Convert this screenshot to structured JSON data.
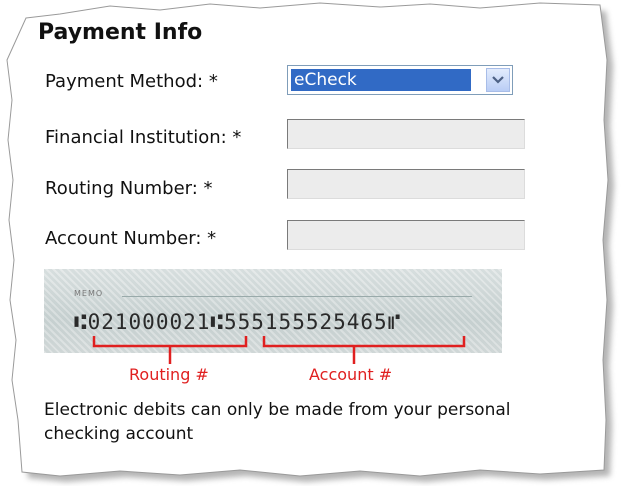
{
  "section_title": "Payment Info",
  "fields": {
    "payment_method": {
      "label": "Payment Method: *",
      "value": "eCheck"
    },
    "financial_institution": {
      "label": "Financial Institution: *",
      "value": ""
    },
    "routing_number": {
      "label": "Routing Number: *",
      "value": ""
    },
    "account_number": {
      "label": "Account Number: *",
      "value": ""
    }
  },
  "check_image": {
    "memo": "MEMO",
    "micr_line": "⑆021000021⑆555155525465⑈",
    "routing_caption": "Routing #",
    "account_caption": "Account #"
  },
  "note": "Electronic debits can only be made from your personal checking account",
  "colors": {
    "selection": "#316ac5",
    "caption_red": "#e02020",
    "field_bg": "#ececec"
  }
}
